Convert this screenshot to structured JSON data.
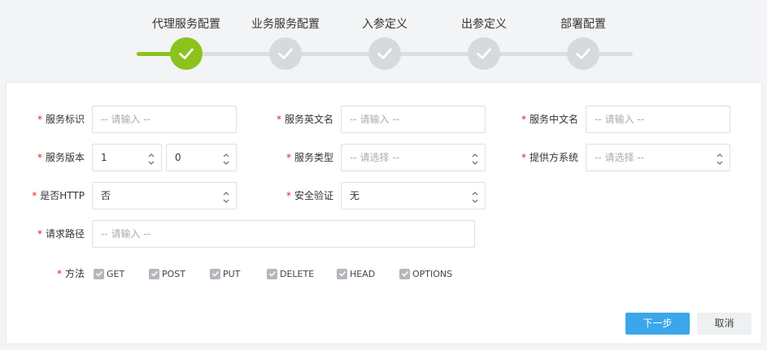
{
  "steps": [
    {
      "label": "代理服务配置",
      "state": "active"
    },
    {
      "label": "业务服务配置",
      "state": "pending"
    },
    {
      "label": "入参定义",
      "state": "pending"
    },
    {
      "label": "出参定义",
      "state": "pending"
    },
    {
      "label": "部署配置",
      "state": "pending"
    }
  ],
  "required_mark": "*",
  "form": {
    "service_id": {
      "label": "服务标识",
      "placeholder": "-- 请输入 --"
    },
    "service_en_name": {
      "label": "服务英文名",
      "placeholder": "-- 请输入 --"
    },
    "service_cn_name": {
      "label": "服务中文名",
      "placeholder": "-- 请输入 --"
    },
    "service_version": {
      "label": "服务版本",
      "major": "1",
      "minor": "0"
    },
    "service_type": {
      "label": "服务类型",
      "placeholder": "-- 请选择 --"
    },
    "provider_system": {
      "label": "提供方系统",
      "placeholder": "-- 请选择 --"
    },
    "is_http": {
      "label": "是否HTTP",
      "value": "否"
    },
    "security_auth": {
      "label": "安全验证",
      "value": "无"
    },
    "request_path": {
      "label": "请求路径",
      "placeholder": "-- 请输入 --"
    },
    "methods": {
      "label": "方法",
      "options": [
        {
          "label": "GET",
          "checked": true
        },
        {
          "label": "POST",
          "checked": true
        },
        {
          "label": "PUT",
          "checked": true
        },
        {
          "label": "DELETE",
          "checked": true
        },
        {
          "label": "HEAD",
          "checked": true
        },
        {
          "label": "OPTIONS",
          "checked": true
        }
      ]
    }
  },
  "buttons": {
    "next": "下一步",
    "cancel": "取消"
  },
  "colors": {
    "active_step": "#8cc21c",
    "pending_step": "#d7dadd",
    "primary": "#3aa7ea",
    "required": "#e0241c"
  }
}
